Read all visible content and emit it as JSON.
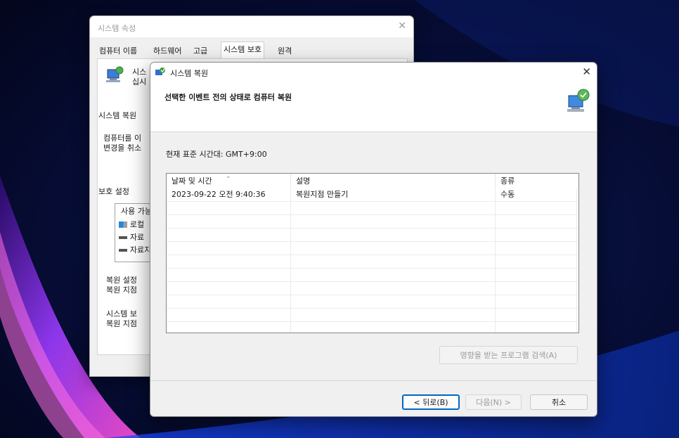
{
  "background_window": {
    "title": "시스템 속성",
    "tabs": [
      "컴퓨터 이름",
      "하드웨어",
      "고급",
      "시스템 보호",
      "원격"
    ],
    "active_tab_index": 3,
    "panel": {
      "intro_line1": "시스",
      "intro_line2": "십시",
      "restore_heading": "시스템 복원",
      "restore_desc_line1": "컴퓨터를 이",
      "restore_desc_line2": "변경을 취소",
      "protection_heading": "보호 설정",
      "drive_list_header": "사용 가능",
      "drives": [
        {
          "label": "로컬",
          "icon": "windows-drive-icon"
        },
        {
          "label": "자료",
          "icon": "drive-icon"
        },
        {
          "label": "자료지",
          "icon": "drive-icon"
        }
      ],
      "configure_line1": "복원 설정",
      "configure_line2": "복원 지점",
      "create_line1": "시스템 보",
      "create_line2": "복원 지점"
    }
  },
  "dialog": {
    "title": "시스템 복원",
    "heading": "선택한 이벤트 전의 상태로 컴퓨터 복원",
    "timezone": "현재 표준 시간대: GMT+9:00",
    "columns": {
      "date": "날짜 및 시간",
      "description": "설명",
      "type": "종류"
    },
    "rows": [
      {
        "date": "2023-09-22 오전 9:40:36",
        "description": "복원지점 만들기",
        "type": "수동"
      },
      {
        "date": "",
        "description": "",
        "type": ""
      },
      {
        "date": "",
        "description": "",
        "type": ""
      },
      {
        "date": "",
        "description": "",
        "type": ""
      },
      {
        "date": "",
        "description": "",
        "type": ""
      },
      {
        "date": "",
        "description": "",
        "type": ""
      },
      {
        "date": "",
        "description": "",
        "type": ""
      },
      {
        "date": "",
        "description": "",
        "type": ""
      },
      {
        "date": "",
        "description": "",
        "type": ""
      },
      {
        "date": "",
        "description": "",
        "type": ""
      },
      {
        "date": "",
        "description": "",
        "type": ""
      }
    ],
    "buttons": {
      "scan": "영향을 받는 프로그램 검색(A)",
      "back": "< 뒤로(B)",
      "next": "다음(N) >",
      "cancel": "취소"
    }
  },
  "colors": {
    "accent": "#0067c0",
    "wallpaper_dark": "#05081f",
    "wallpaper_glow": "#7a2fd0"
  }
}
